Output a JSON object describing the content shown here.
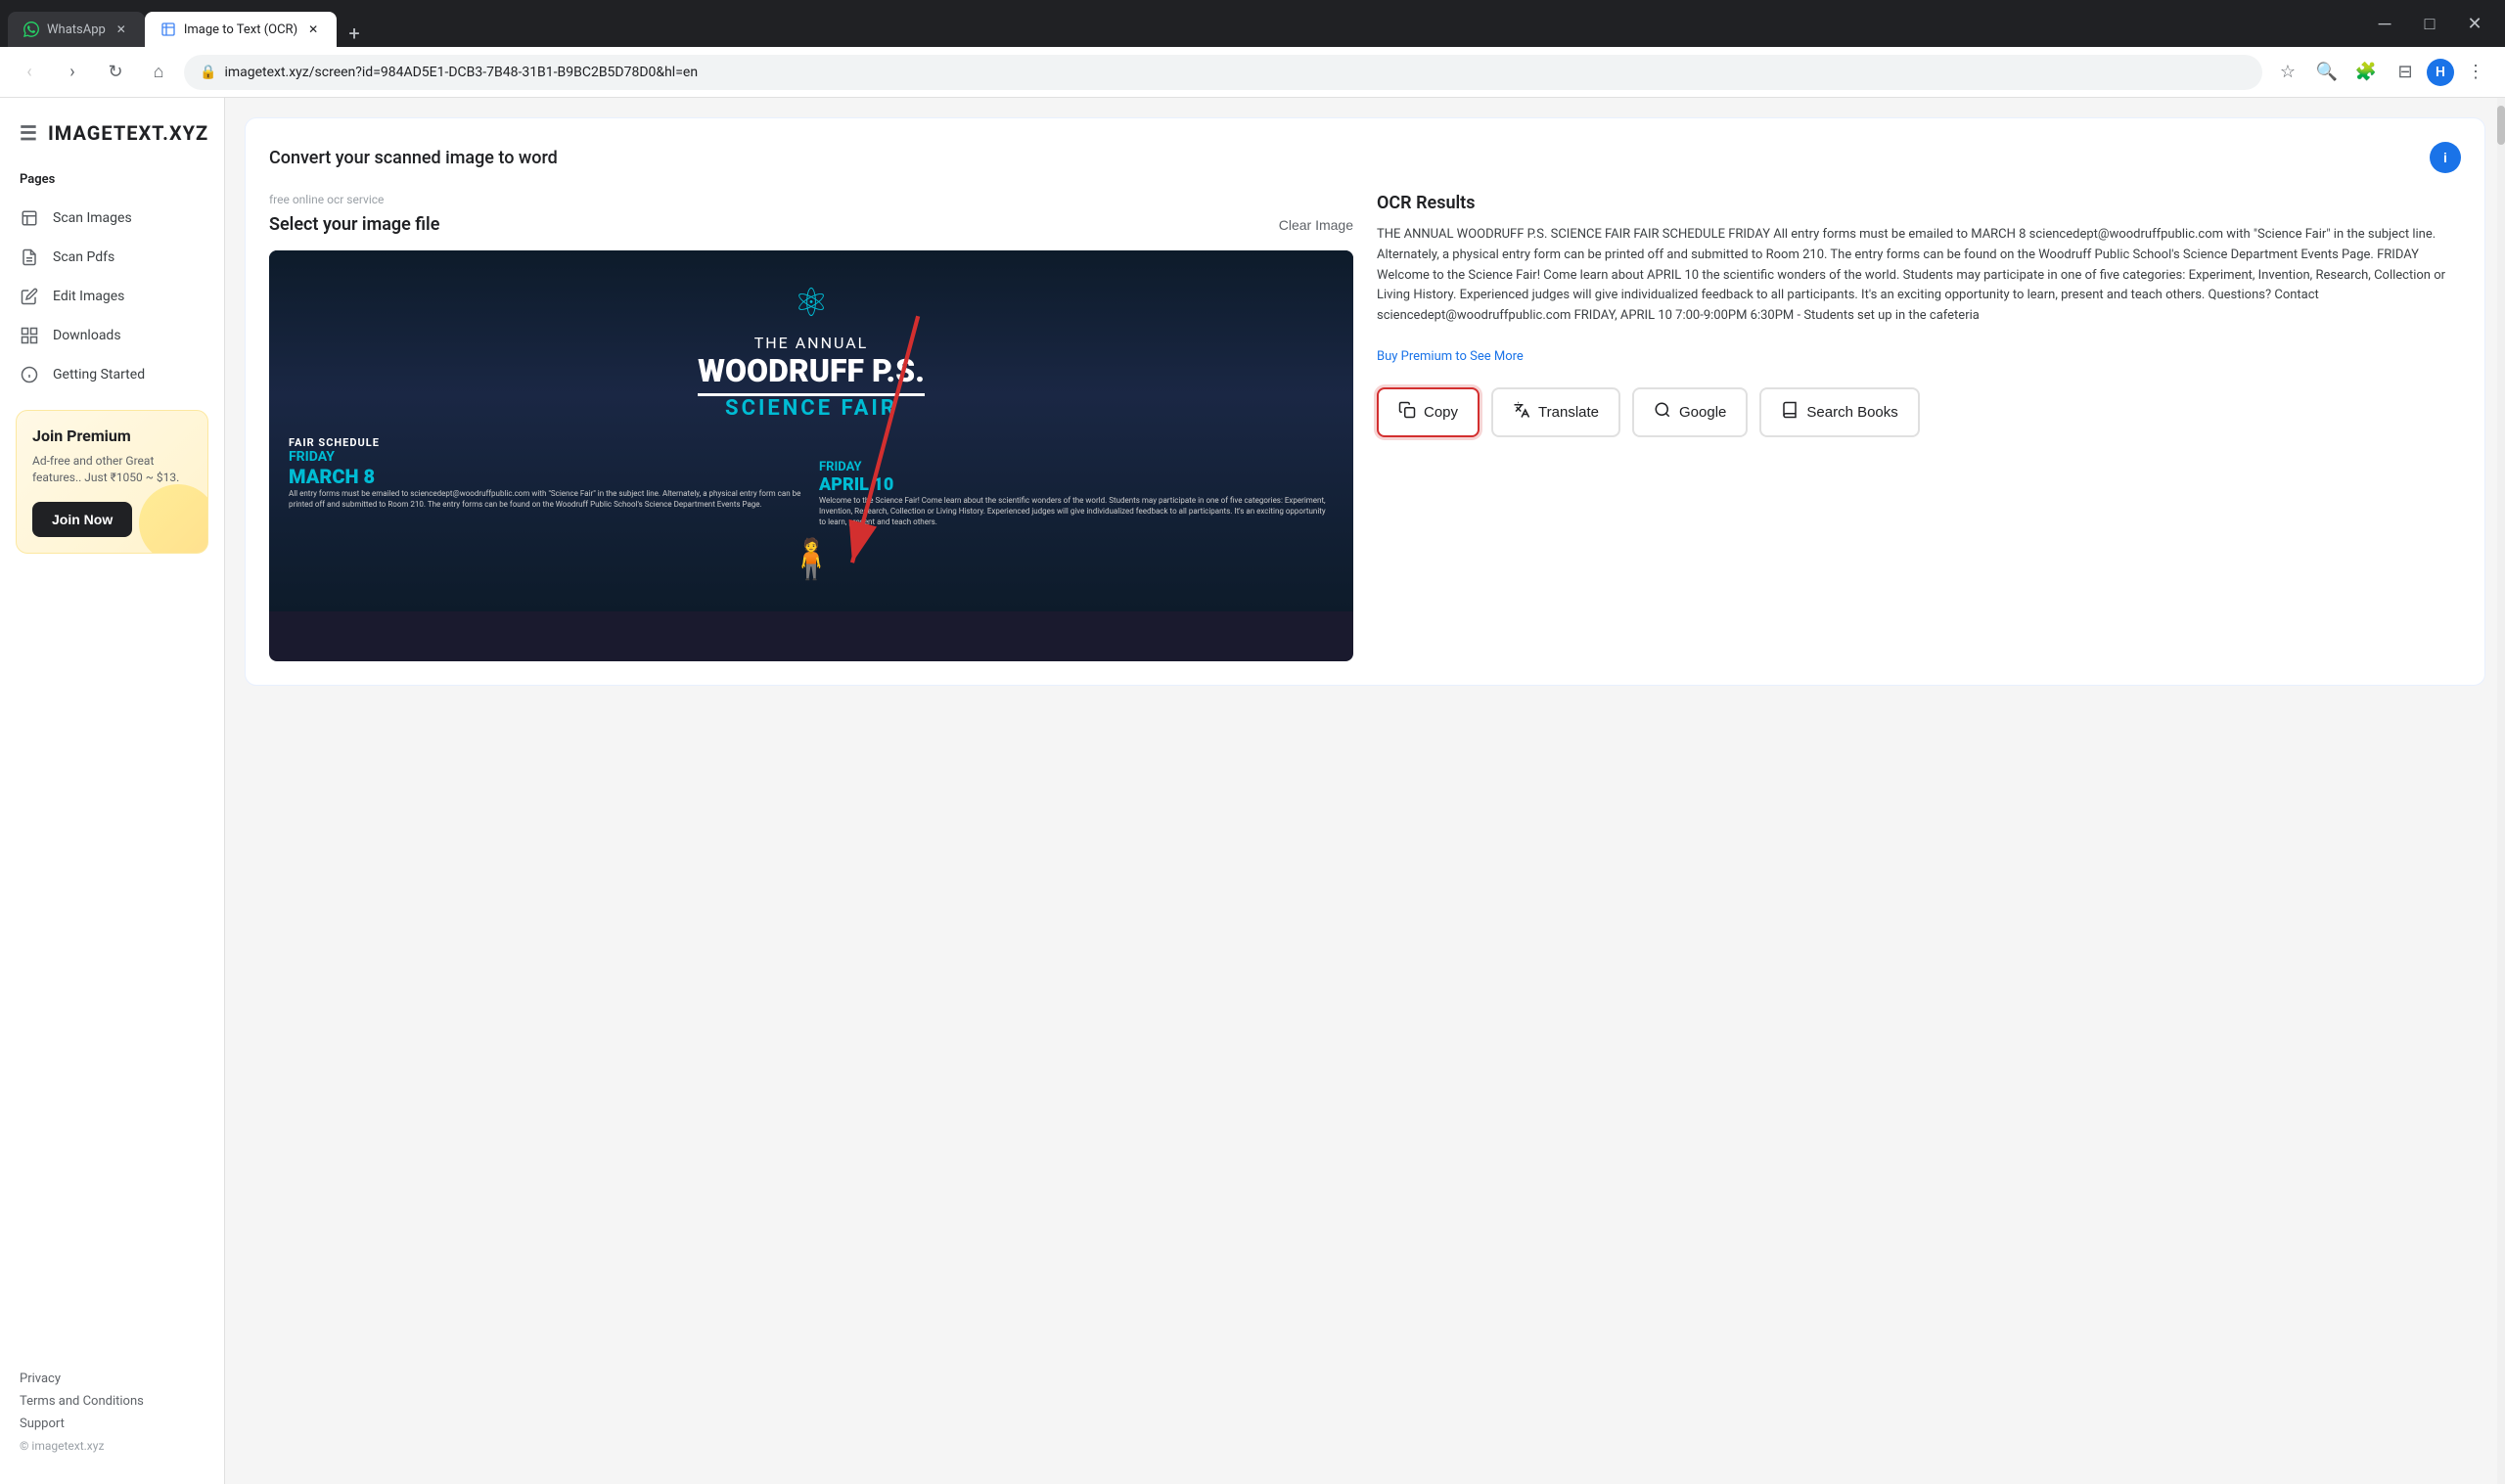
{
  "browser": {
    "tabs": [
      {
        "id": "whatsapp",
        "label": "WhatsApp",
        "favicon_type": "whatsapp",
        "active": false
      },
      {
        "id": "ocr",
        "label": "Image to Text (OCR)",
        "favicon_type": "ocr",
        "active": true
      }
    ],
    "new_tab_label": "+",
    "address": "imagetext.xyz/screen?id=984AD5E1-DCB3-7B48-31B1-B9BC2B5D78D0&hl=en",
    "window_controls": {
      "minimize": "─",
      "maximize": "□",
      "close": "✕"
    }
  },
  "sidebar": {
    "logo": "IMAGETEXT.XYZ",
    "pages_label": "Pages",
    "items": [
      {
        "id": "scan-images",
        "label": "Scan Images",
        "icon": "📄"
      },
      {
        "id": "scan-pdfs",
        "label": "Scan Pdfs",
        "icon": "📋"
      },
      {
        "id": "edit-images",
        "label": "Edit Images",
        "icon": "✏️"
      },
      {
        "id": "downloads",
        "label": "Downloads",
        "icon": "⊞"
      },
      {
        "id": "getting-started",
        "label": "Getting Started",
        "icon": "ℹ️"
      }
    ],
    "premium": {
      "title": "Join Premium",
      "description": "Ad-free and other Great features.. Just ₹1050 ~ $13.",
      "join_button": "Join Now"
    },
    "links": [
      "Privacy",
      "Terms and Conditions",
      "Support"
    ],
    "copyright": "© imagetext.xyz"
  },
  "main": {
    "page_title": "Convert your scanned image to word",
    "upload": {
      "service_label": "free online ocr service",
      "select_label": "Select your image file",
      "clear_button": "Clear Image"
    },
    "ocr": {
      "title": "OCR Results",
      "text": "THE ANNUAL WOODRUFF P.S. SCIENCE FAIR FAIR SCHEDULE FRIDAY All entry forms must be emailed to MARCH 8 sciencedept@woodruffpublic.com with \"Science Fair\" in the subject line. Alternately, a physical entry form can be printed off and submitted to Room 210. The entry forms can be found on the Woodruff Public School's Science Department Events Page. FRIDAY Welcome to the Science Fair! Come learn about APRIL 10 the scientific wonders of the world. Students may participate in one of five categories: Experiment, Invention, Research, Collection or Living History. Experienced judges will give individualized feedback to all participants. It's an exciting opportunity to learn, present and teach others. Questions? Contact sciencedept@woodruffpublic.com FRIDAY, APRIL 10 7:00-9:00PM 6:30PM - Students set up in the cafeteria",
      "premium_link": "Buy Premium to See More"
    },
    "actions": [
      {
        "id": "copy",
        "label": "Copy",
        "icon": "📋",
        "highlighted": true
      },
      {
        "id": "translate",
        "label": "Translate",
        "icon": "🌐"
      },
      {
        "id": "google",
        "label": "Google",
        "icon": "🔍"
      },
      {
        "id": "search-books",
        "label": "Search Books",
        "icon": "📖"
      }
    ]
  },
  "science_fair": {
    "annual": "THE ANNUAL",
    "school": "WOODRUFF P.S.",
    "event": "SCIENCE FAIR",
    "schedule": "FAIR SCHEDULE",
    "friday1": "FRIDAY",
    "march": "MARCH 8",
    "friday2": "FRIDAY",
    "april": "APRIL 10"
  }
}
